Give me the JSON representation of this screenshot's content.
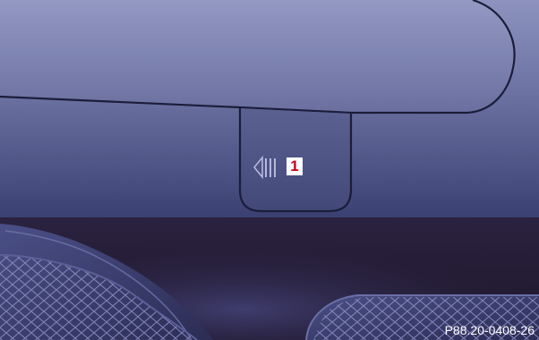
{
  "callout": {
    "number": "1"
  },
  "figure": {
    "code": "P88.20-0408-26"
  },
  "icons": {
    "release_symbol": "triangle-with-bars-icon"
  },
  "colors": {
    "panel_top": "#8a90bb",
    "panel_bottom": "#3d4374",
    "dark_area": "#231a33",
    "callout_text": "#c4001a",
    "callout_bg": "#ffffff",
    "figure_code_text": "#ffffff"
  }
}
